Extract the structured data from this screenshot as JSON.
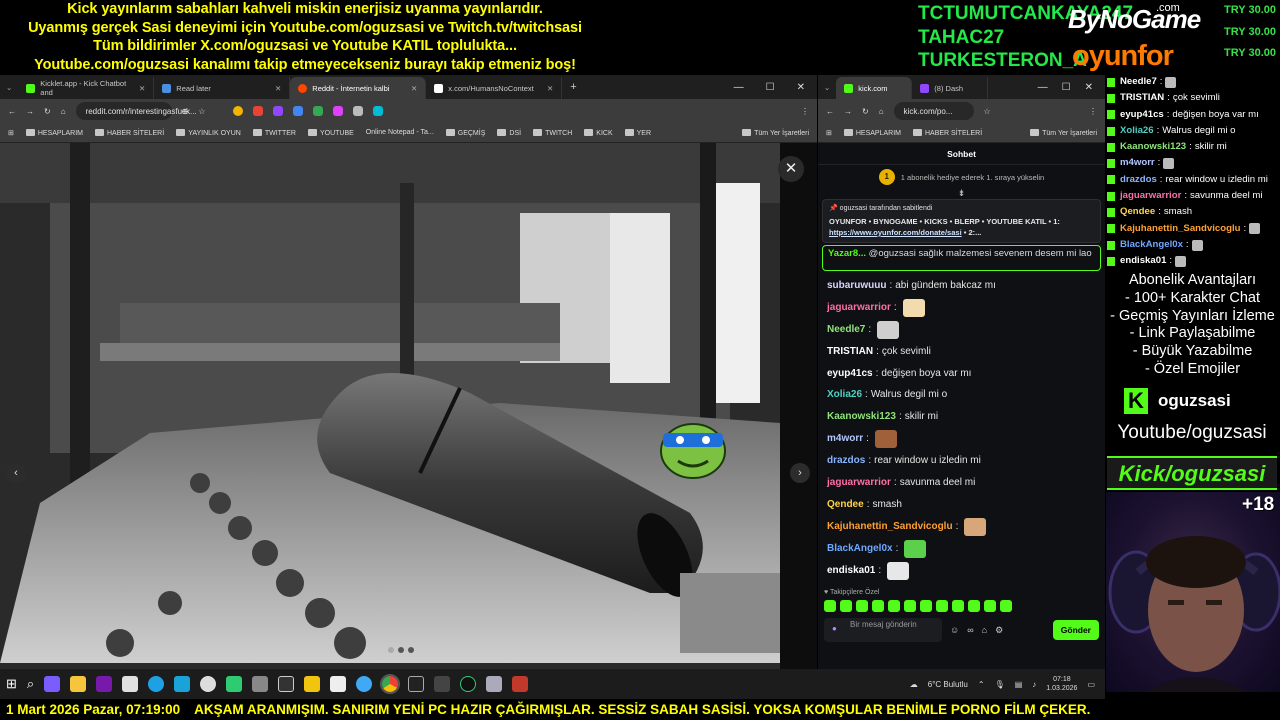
{
  "top_banner": [
    "Kick yayınlarım sabahları kahveli miskin enerjisiz uyanma yayınlarıdır.",
    "Uyanmış gerçek Sasi deneyimi için Youtube.com/oguzsasi ve Twitch.tv/twitchsasi",
    "Tüm bildirimler X.com/oguzsasi ve Youtube KATIL toplulukta...",
    "Youtube.com/oguzsasi kanalımı takip etmeyecekseniz burayı takip etmeniz boş!"
  ],
  "donors": [
    "TCTUMUTCANKAYA247",
    "TAHAC27",
    "TURKESTERON_A"
  ],
  "sponsors": {
    "bynogame": "ByNoGame",
    "bynogame_suffix": ".com",
    "oyunfor": "oyunfor"
  },
  "donation_amounts": [
    "TRY 30.00",
    "TRY 30.00",
    "TRY 30.00"
  ],
  "left_browser": {
    "tabs": [
      {
        "label": "Kicklet.app - Kick Chatbot and",
        "color": "#53fc18"
      },
      {
        "label": "Read later",
        "color": "#4a90e2"
      },
      {
        "label": "Reddit - İnternetin kalbi",
        "color": "#ff4500"
      },
      {
        "label": "x.com/HumansNoContext",
        "color": "#ffffff"
      }
    ],
    "url": "reddit.com/r/interestingasfuck...",
    "bookmarks": [
      "HESAPLARIM",
      "HABER SİTELERİ",
      "YAYINLIK OYUN",
      "TWITTER",
      "YOUTUBE",
      "Online Notepad - Ta...",
      "GEÇMİŞ",
      "DSİ",
      "TWITCH",
      "KICK",
      "YER",
      "Tüm Yer İşaretleri"
    ],
    "close_glyph": "✕",
    "prev_glyph": "‹",
    "next_glyph": "›"
  },
  "right_browser": {
    "tabs": [
      {
        "label": "kick.com",
        "color": "#53fc18"
      },
      {
        "label": "(8) Dash",
        "color": "#9146ff"
      }
    ],
    "url": "kick.com/po...",
    "bookmarks": [
      "HESAPLARIM",
      "HABER SİTELERİ",
      "Tüm Yer İşaretleri"
    ],
    "chat_title": "Sohbet",
    "sub_gift_count": "1",
    "sub_gift_text": "1 abonelik hediye ederek 1. sıraya yükselin",
    "pinned_by": "oguzsasi tarafından sabitlendi",
    "pinned_message": "OYUNFOR • BYNOGAME • KICKS • BLERP • YOUTUBE KATIL • 1: ",
    "pinned_link": "https://www.oyunfor.com/donate/sasi",
    "pinned_suffix": " • 2:...",
    "highlight_user": "Yazar8...",
    "highlight_text": "@oguzsasi sağlık malzemesi sevenem desem mi lao",
    "messages": [
      {
        "user": "subaruwuuu",
        "color": "#d9d6ff",
        "text": "abi gündem bakcaz mı",
        "emote": ""
      },
      {
        "user": "jaguarwarrior",
        "color": "#ff6ea8",
        "text": "",
        "emote": "#f2dcae"
      },
      {
        "user": "Needle7",
        "color": "#8fe37a",
        "text": "",
        "emote": "#cfcfcf"
      },
      {
        "user": "TRISTIAN",
        "color": "#ffffff",
        "text": "çok sevimli",
        "emote": ""
      },
      {
        "user": "eyup41cs",
        "color": "#ffffff",
        "text": "değişen boya var mı",
        "emote": ""
      },
      {
        "user": "Xolia26",
        "color": "#4fd1c5",
        "text": "Walrus degil mi o",
        "emote": ""
      },
      {
        "user": "Kaanowski123",
        "color": "#8fe37a",
        "text": "skilir mi",
        "emote": ""
      },
      {
        "user": "m4worr",
        "color": "#b3c7ff",
        "text": "",
        "emote": "#a0603a"
      },
      {
        "user": "drazdos",
        "color": "#8ab4ff",
        "text": "rear window u izledin mi",
        "emote": ""
      },
      {
        "user": "jaguarwarrior",
        "color": "#ff6ea8",
        "text": "savunma deel mi",
        "emote": ""
      },
      {
        "user": "Qendee",
        "color": "#ffd44a",
        "text": "smash",
        "emote": ""
      },
      {
        "user": "Kajuhanettin_Sandvicoglu",
        "color": "#ffa033",
        "text": "",
        "emote": "#d7a67a"
      },
      {
        "user": "BlackAngel0x",
        "color": "#6ea8ff",
        "text": "",
        "emote": "#5bd04a"
      },
      {
        "user": "endiska01",
        "color": "#ffffff",
        "text": "",
        "emote": "#e7e7e7"
      }
    ],
    "followers_only": "Takipçilere Özel",
    "input_placeholder": "Bir mesaj gönderin",
    "send_label": "Gönder"
  },
  "overlay_chat": [
    {
      "user": "Needle7",
      "color": "#ffffff",
      "text": ""
    },
    {
      "user": "TRISTIAN",
      "color": "#ffffff",
      "text": "çok sevimli"
    },
    {
      "user": "eyup41cs",
      "color": "#ffffff",
      "text": "değişen boya var mı"
    },
    {
      "user": "Xolia26",
      "color": "#4fd1c5",
      "text": "Walrus degil mi o"
    },
    {
      "user": "Kaanowski123",
      "color": "#8fe37a",
      "text": "skilir mi"
    },
    {
      "user": "m4worr",
      "color": "#b3c7ff",
      "text": ""
    },
    {
      "user": "drazdos",
      "color": "#8ab4ff",
      "text": "rear window u izledin mi"
    },
    {
      "user": "jaguarwarrior",
      "color": "#ff6ea8",
      "text": "savunma deel mi"
    },
    {
      "user": "Qendee",
      "color": "#ffd44a",
      "text": "smash"
    },
    {
      "user": "Kajuhanettin_Sandvicoglu",
      "color": "#ffa033",
      "text": ""
    },
    {
      "user": "BlackAngel0x",
      "color": "#6ea8ff",
      "text": ""
    },
    {
      "user": "endiska01",
      "color": "#ffffff",
      "text": ""
    }
  ],
  "sub_perks": [
    "Abonelik Avantajları",
    "- 100+ Karakter Chat",
    "- Geçmiş Yayınları İzleme",
    "- Link Paylaşabilme",
    "- Büyük Yazabilme",
    "- Özel Emojiler"
  ],
  "kick_name": "oguzsasi",
  "youtube_handle": "Youtube/oguzsasi",
  "kick_url": "Kick/oguzsasi",
  "plus_count": "+18",
  "taskbar": {
    "weather": "6°C  Bulutlu",
    "time": "07:18",
    "date": "1.03.2026"
  },
  "ticker": {
    "datetime": "1 Mart 2026 Pazar, 07:19:00",
    "text": "AKŞAM ARANMIŞIM. SANIRIM YENİ PC HAZIR ÇAĞIRMIŞLAR. SESSİZ SABAH SASİSİ. YOKSA KOMŞULAR BENİMLE PORNO FİLM ÇEKER."
  },
  "colors": {
    "kick_green": "#53fc18",
    "banner_yellow": "#ffff00",
    "donor_green": "#24e84a"
  }
}
